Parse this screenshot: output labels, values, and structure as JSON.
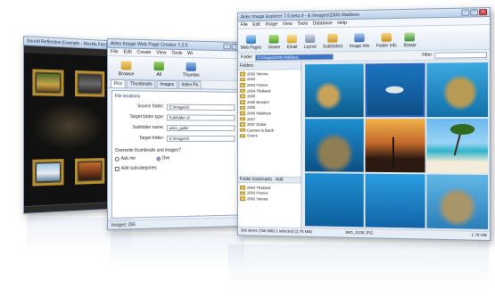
{
  "colors": {
    "accent": "#3a74c9",
    "frame_gold": "#b8902f",
    "titlebar": "#b9cfe8",
    "ocean_blue": "#1e8fd2"
  },
  "window_slideshow": {
    "title": "Sound Reflection Example - Mozilla Firefox"
  },
  "window_web_creator": {
    "title": "Arles Image Web Page Creator 7.2.5",
    "menu": [
      "File",
      "Edit",
      "Create",
      "View",
      "Tools",
      "Wi"
    ],
    "toolbar": [
      {
        "label": "Browse",
        "icon": "browse-icon"
      },
      {
        "label": "All",
        "icon": "all-icon"
      },
      {
        "label": "Thumbn",
        "icon": "thumbnail-icon"
      }
    ],
    "tabs": [
      "Pics",
      "Thumbnails",
      "Images",
      "Index Pa"
    ],
    "group_title": "File locations",
    "fields": [
      {
        "label": "Source folder:",
        "value": "E:\\Images\\2"
      },
      {
        "label": "Target folder type:",
        "value": "Subfolder of"
      },
      {
        "label": "Subfolder name:",
        "value": "arles_galler"
      },
      {
        "label": "Target folder:",
        "value": "E:\\Images\\2"
      }
    ],
    "overwrite_question": "Overwrite thumbnails and images?",
    "radio_options": [
      "Ask me",
      "Ove"
    ],
    "checkbox_label": "Add subcategories",
    "status": "Images: 356"
  },
  "window_explorer": {
    "title": "Arles Image Explorer 7.5 beta 9 - E:\\Images\\2006 Maldives",
    "menu": [
      "File",
      "Edit",
      "Image",
      "View",
      "Tools",
      "Database",
      "Help"
    ],
    "toolbar": [
      {
        "label": "Web Pages",
        "icon": "web-pages-icon"
      },
      {
        "label": "Viewer",
        "icon": "viewer-icon"
      },
      {
        "label": "Email",
        "icon": "email-icon"
      },
      {
        "label": "Layout",
        "icon": "layout-icon"
      },
      {
        "label": "Subfolders",
        "icon": "subfolders-icon"
      },
      {
        "label": "Image Info",
        "icon": "image-info-icon"
      },
      {
        "label": "Folder Info",
        "icon": "folder-info-icon"
      },
      {
        "label": "Rotate",
        "icon": "rotate-icon"
      }
    ],
    "folder_label": "Folder:",
    "folder_value": "E:\\Images\\2006 Maldives",
    "filter_label": "Filter:",
    "folders_header": "Folders",
    "folders": [
      "2002 Vienna",
      "2003",
      "2003 France",
      "2004 Thailand",
      "2005",
      "2005 Bonaire",
      "2006",
      "2006 Maldives",
      "2007",
      "2007 Dubai",
      "Cannes la Bardi",
      "Scans"
    ],
    "bookmarks_header": "Folder bookmarks · Add",
    "bookmarks": [
      "2004 Thailand",
      "2003 France",
      "2002 Vienna"
    ],
    "status": {
      "items": "356 items (756 MB) 1 selected (2.78 MB)",
      "file": "IMG_5238.JPG",
      "size": "1.78 MB"
    }
  }
}
